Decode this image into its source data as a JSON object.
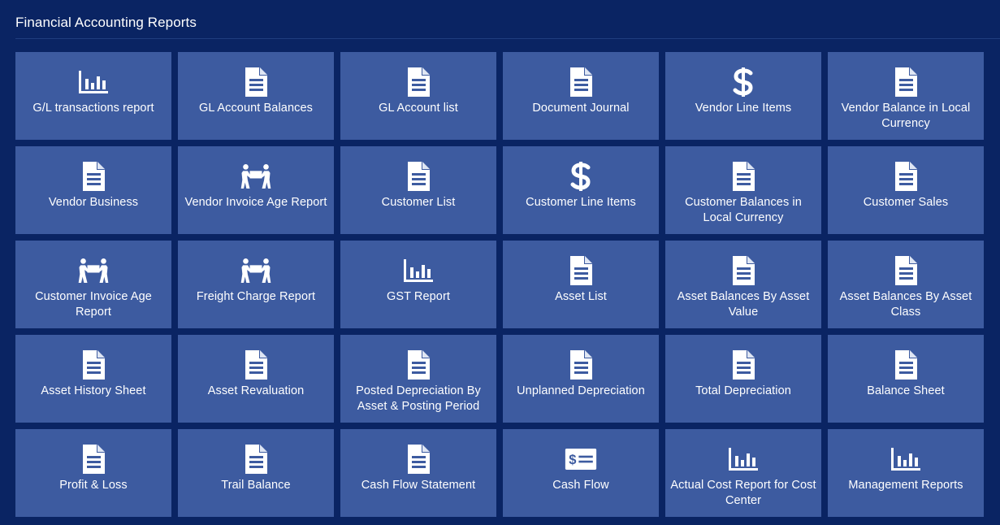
{
  "page": {
    "title": "Financial Accounting Reports"
  },
  "colors": {
    "background": "#0a2463",
    "tile": "#3d5ba0",
    "text": "#ffffff"
  },
  "tiles": [
    {
      "label": "G/L transactions report",
      "icon": "bar-chart-icon"
    },
    {
      "label": "GL Account Balances",
      "icon": "document-icon"
    },
    {
      "label": "GL Account list",
      "icon": "document-icon"
    },
    {
      "label": "Document Journal",
      "icon": "document-icon"
    },
    {
      "label": "Vendor Line Items",
      "icon": "dollar-icon"
    },
    {
      "label": "Vendor Balance in Local Currency",
      "icon": "document-icon"
    },
    {
      "label": "Vendor Business",
      "icon": "document-icon"
    },
    {
      "label": "Vendor Invoice Age Report",
      "icon": "people-carry-icon"
    },
    {
      "label": "Customer List",
      "icon": "document-icon"
    },
    {
      "label": "Customer Line Items",
      "icon": "dollar-icon"
    },
    {
      "label": "Customer Balances in Local Currency",
      "icon": "document-icon"
    },
    {
      "label": "Customer Sales",
      "icon": "document-icon"
    },
    {
      "label": "Customer Invoice Age Report",
      "icon": "people-carry-icon"
    },
    {
      "label": "Freight Charge Report",
      "icon": "people-carry-icon"
    },
    {
      "label": "GST Report",
      "icon": "bar-chart-icon"
    },
    {
      "label": "Asset List",
      "icon": "document-icon"
    },
    {
      "label": "Asset Balances By Asset Value",
      "icon": "document-icon"
    },
    {
      "label": "Asset Balances By Asset Class",
      "icon": "document-icon"
    },
    {
      "label": "Asset History Sheet",
      "icon": "document-icon"
    },
    {
      "label": "Asset Revaluation",
      "icon": "document-icon"
    },
    {
      "label": "Posted Depreciation By Asset & Posting Period",
      "icon": "document-icon"
    },
    {
      "label": "Unplanned Depreciation",
      "icon": "document-icon"
    },
    {
      "label": "Total Depreciation",
      "icon": "document-icon"
    },
    {
      "label": "Balance Sheet",
      "icon": "document-icon"
    },
    {
      "label": "Profit & Loss",
      "icon": "document-icon"
    },
    {
      "label": "Trail Balance",
      "icon": "document-icon"
    },
    {
      "label": "Cash Flow Statement",
      "icon": "document-icon"
    },
    {
      "label": "Cash Flow",
      "icon": "money-bill-icon"
    },
    {
      "label": "Actual Cost Report for Cost Center",
      "icon": "bar-chart-icon"
    },
    {
      "label": "Management Reports",
      "icon": "bar-chart-icon"
    }
  ]
}
